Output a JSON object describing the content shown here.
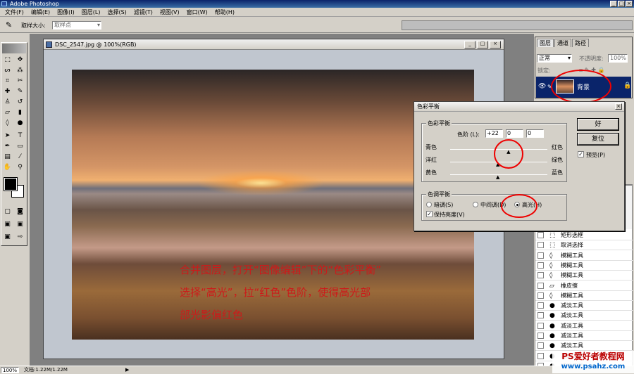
{
  "app": {
    "title": "Adobe Photoshop"
  },
  "menu": [
    "文件(F)",
    "编辑(E)",
    "图像(I)",
    "图层(L)",
    "选择(S)",
    "滤镜(T)",
    "视图(V)",
    "窗口(W)",
    "帮助(H)"
  ],
  "options": {
    "sample_label": "取样大小:",
    "sample_value": "取样点"
  },
  "document": {
    "title": "DSC_2547.jpg @ 100%(RGB)"
  },
  "layers_panel": {
    "tabs": [
      "图层",
      "通道",
      "路径"
    ],
    "blend_mode": "正常",
    "opacity_label": "不透明度:",
    "opacity_value": "100%",
    "lock_label": "锁定:",
    "layer_name": "背景"
  },
  "dialog": {
    "title": "色彩平衡",
    "group1": "色彩平衡",
    "levels_label": "色阶 (L):",
    "levels": [
      "+22",
      "0",
      "0"
    ],
    "sliders": [
      {
        "left": "青色",
        "right": "红色",
        "value": 22
      },
      {
        "left": "洋红",
        "right": "绿色",
        "value": 0
      },
      {
        "left": "黄色",
        "right": "蓝色",
        "value": 0
      }
    ],
    "group2": "色调平衡",
    "tones": [
      "暗调(S)",
      "中间调(D)",
      "高光(H)"
    ],
    "selected_tone": "高光(H)",
    "preserve": "保持亮度(V)",
    "ok": "好",
    "reset": "复位",
    "preview": "预览(P)"
  },
  "history": [
    {
      "icon": "rect-marquee-icon",
      "glyph": "⬚",
      "label": "矩形选框"
    },
    {
      "icon": "deselect-icon",
      "glyph": "⬚",
      "label": "取消选择"
    },
    {
      "icon": "blur-icon",
      "glyph": "◊",
      "label": "模糊工具"
    },
    {
      "icon": "blur-icon",
      "glyph": "◊",
      "label": "模糊工具"
    },
    {
      "icon": "blur-icon",
      "glyph": "◊",
      "label": "模糊工具"
    },
    {
      "icon": "eraser-icon",
      "glyph": "▱",
      "label": "橡皮擦"
    },
    {
      "icon": "blur-icon",
      "glyph": "◊",
      "label": "模糊工具"
    },
    {
      "icon": "dodge-icon",
      "glyph": "●",
      "label": "减淡工具"
    },
    {
      "icon": "dodge-icon",
      "glyph": "●",
      "label": "减淡工具"
    },
    {
      "icon": "dodge-icon",
      "glyph": "●",
      "label": "减淡工具"
    },
    {
      "icon": "dodge-icon",
      "glyph": "●",
      "label": "减淡工具"
    },
    {
      "icon": "dodge-icon",
      "glyph": "●",
      "label": "减淡工具"
    },
    {
      "icon": "dodge-icon",
      "glyph": "●",
      "label": "减淡工具"
    },
    {
      "icon": "dodge-icon",
      "glyph": "●",
      "label": "减淡工具"
    }
  ],
  "annotation": [
    "合并图层，打开“图像编辑”下的“色彩平衡”",
    "选择“高光”，拉“红色”色阶，使得高光部",
    "部光影偏红色"
  ],
  "status": {
    "zoom": "100%",
    "doc": "文档:1.22M/1.22M"
  },
  "watermark": {
    "line1": "PS爱好者教程网",
    "line2": "www.psahz.com"
  },
  "colors": {
    "annotation": "#cc1a1a",
    "highlight_circle": "#ee0000"
  }
}
